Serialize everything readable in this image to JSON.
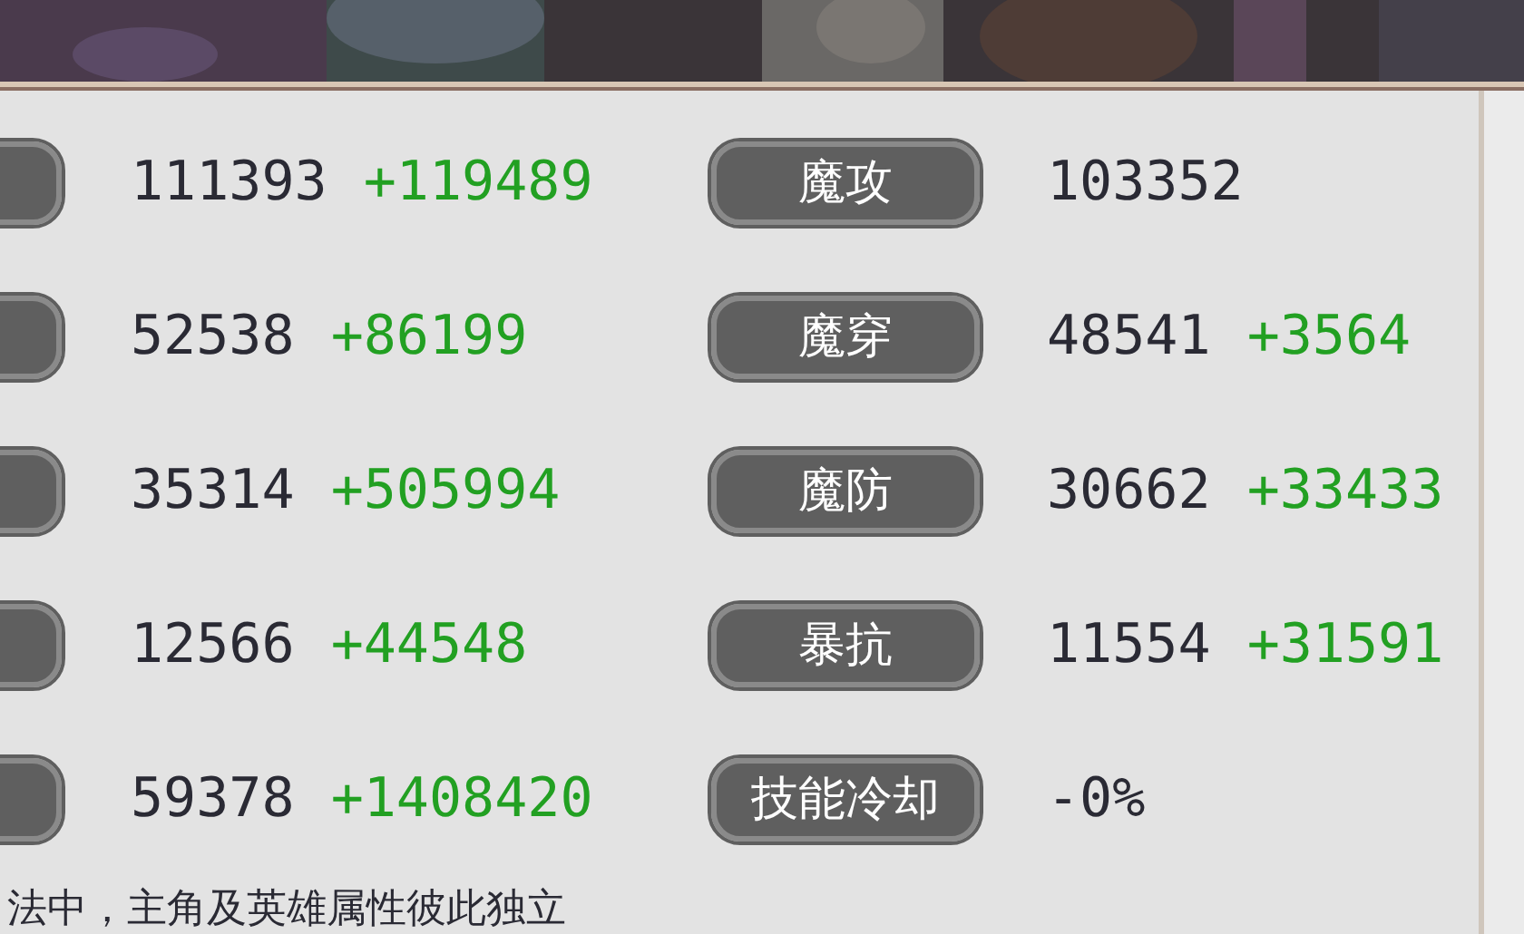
{
  "stats": [
    {
      "left": {
        "value": "111393",
        "bonus": "+119489"
      },
      "right": {
        "label": "魔攻",
        "value": "103352"
      }
    },
    {
      "left": {
        "value": "52538",
        "bonus": "+86199"
      },
      "right": {
        "label": "魔穿",
        "value": "48541",
        "bonus": "+3564"
      }
    },
    {
      "left": {
        "value": "35314",
        "bonus": "+505994"
      },
      "right": {
        "label": "魔防",
        "value": "30662",
        "bonus": "+33433"
      }
    },
    {
      "left": {
        "value": "12566",
        "bonus": "+44548"
      },
      "right": {
        "label": "暴抗",
        "value": "11554",
        "bonus": "+31591"
      }
    },
    {
      "left": {
        "value": "59378",
        "bonus": "+1408420"
      },
      "right": {
        "label": "技能冷却",
        "value": "-0%"
      }
    }
  ],
  "note": "法中，主角及英雄属性彼此独立"
}
